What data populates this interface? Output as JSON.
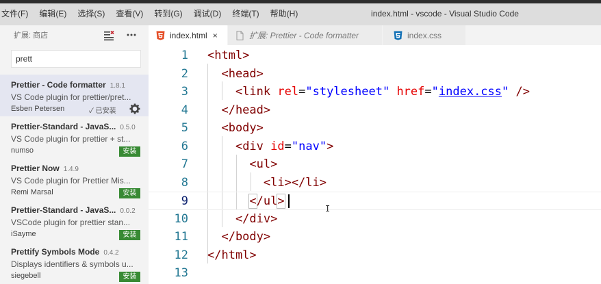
{
  "menu": [
    "文件(F)",
    "编辑(E)",
    "选择(S)",
    "查看(V)",
    "转到(G)",
    "调试(D)",
    "终端(T)",
    "帮助(H)"
  ],
  "window_title": "index.html - vscode - Visual Studio Code",
  "sidebar": {
    "title": "扩展: 商店",
    "search_value": "prett",
    "extensions": [
      {
        "name": "Prettier - Code formatter",
        "version": "1.8.1",
        "description": "VS Code plugin for prettier/pret...",
        "author": "Esben Petersen",
        "status": "✓ 已安装"
      },
      {
        "name": "Prettier-Standard - JavaS...",
        "version": "0.5.0",
        "description": "VS Code plugin for prettier + st...",
        "author": "numso",
        "status": "安装"
      },
      {
        "name": "Prettier Now",
        "version": "1.4.9",
        "description": "VS Code plugin for Prettier Mis...",
        "author": "Remi Marsal",
        "status": "安装"
      },
      {
        "name": "Prettier-Standard - JavaS...",
        "version": "0.0.2",
        "description": "VSCode plugin for prettier stan...",
        "author": "iSayme",
        "status": "安装"
      },
      {
        "name": "Prettify Symbols Mode",
        "version": "0.4.2",
        "description": "Displays identifiers & symbols u...",
        "author": "siegebell",
        "status": "安装"
      }
    ]
  },
  "tabs": [
    {
      "label": "index.html",
      "icon": "html5-icon",
      "active": true,
      "close": "×"
    },
    {
      "label": "扩展: Prettier - Code formatter",
      "icon": "file-icon",
      "active": false
    },
    {
      "label": "index.css",
      "icon": "css3-icon",
      "active": false
    }
  ],
  "editor": {
    "line_numbers": [
      "1",
      "2",
      "3",
      "4",
      "5",
      "6",
      "7",
      "8",
      "9",
      "10",
      "11",
      "12",
      "13"
    ],
    "current_line": 9,
    "lines": [
      "<html>",
      "  <head>",
      "    <link rel=\"stylesheet\" href=\"index.css\" />",
      "  </head>",
      "  <body>",
      "    <div id=\"nav\">",
      "      <ul>",
      "        <li></li>",
      "      </ul>",
      "    </div>",
      "  </body>",
      "</html>",
      ""
    ]
  },
  "colors": {
    "tag": "#800000",
    "attribute": "#e50000",
    "value": "#0000ff",
    "line_number": "#237893",
    "install_button": "#388a34",
    "selected_item": "#e4e6f1"
  }
}
